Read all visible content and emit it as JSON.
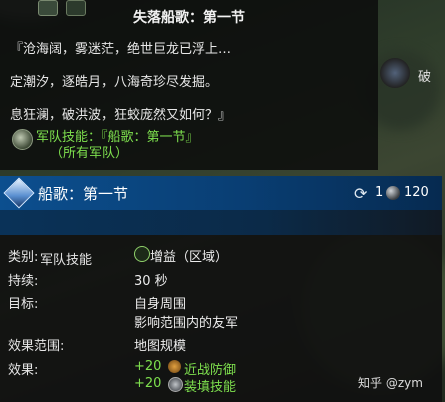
{
  "tooltip": {
    "title": "失落船歌：第一节",
    "quote_lines": [
      "『沧海阔，雾迷茫，绝世巨龙已浮上…",
      "定潮汐，逐皓月，八海奇珍尽发掘。",
      "息狂澜，破洪波，狂蛟庞然又如何？』"
    ],
    "skill_link_line1": "军队技能：『船歌：第一节』",
    "skill_link_line2": "（所有军队）",
    "right_text": "破"
  },
  "panel": {
    "title": "船歌：第一节",
    "type": "军队技能",
    "cooldown": "1",
    "cost": "120",
    "rows": {
      "category_label": "类别:",
      "category_value": "增益（区域）",
      "duration_label": "持续:",
      "duration_value": "30 秒",
      "target_label": "目标:",
      "target_value_1": "自身周围",
      "target_value_2": "影响范围内的友军",
      "range_label": "效果范围:",
      "range_value": "地图规模",
      "effect_label": "效果:",
      "effects": [
        {
          "amount": "+20",
          "name": "近战防御"
        },
        {
          "amount": "+20",
          "name": "装填技能"
        }
      ]
    }
  },
  "watermark": "知乎 @zym"
}
